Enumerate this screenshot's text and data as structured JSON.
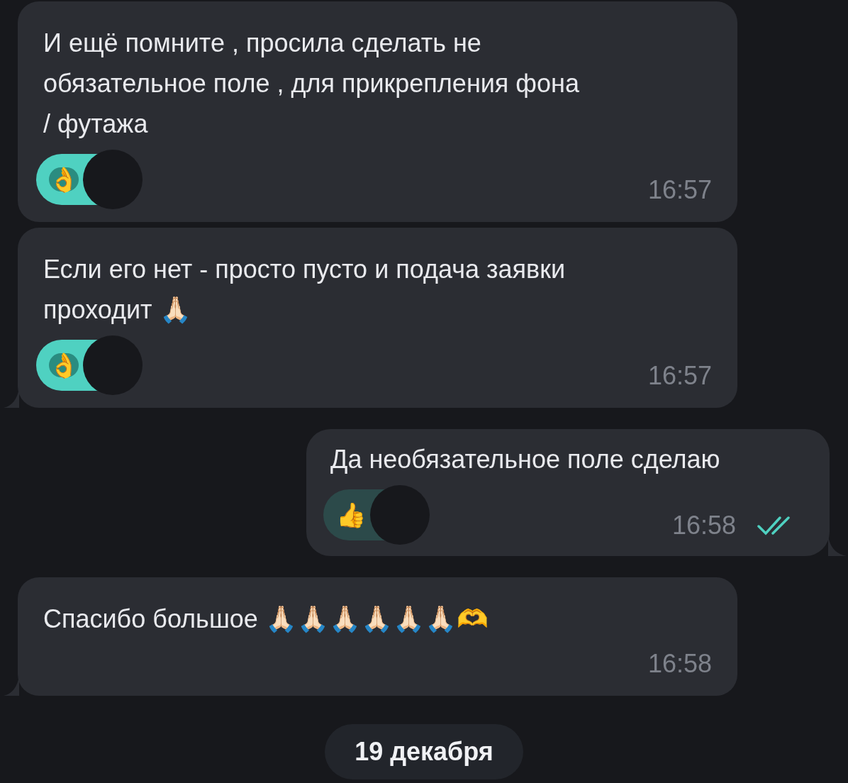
{
  "messages": [
    {
      "kind": "incoming",
      "text": "И ещё помните , просила сделать не\nобязательное поле , для прикрепления фона\n/ футажа",
      "reaction": "👌",
      "time": "16:57",
      "tail": false
    },
    {
      "kind": "incoming",
      "text": "Если его нет - просто пусто и подача заявки\nпроходит 🙏🏻",
      "reaction": "👌",
      "time": "16:57",
      "tail": true
    },
    {
      "kind": "outgoing",
      "text": "Да необязательное поле сделаю",
      "reaction": "👍",
      "time": "16:58",
      "read": true,
      "tail": true
    },
    {
      "kind": "incoming",
      "text": "Спасибо большое 🙏🏻🙏🏻🙏🏻🙏🏻🙏🏻🙏🏻🫶",
      "time": "16:58",
      "tail": true
    }
  ],
  "date_badge": "19 декабря"
}
